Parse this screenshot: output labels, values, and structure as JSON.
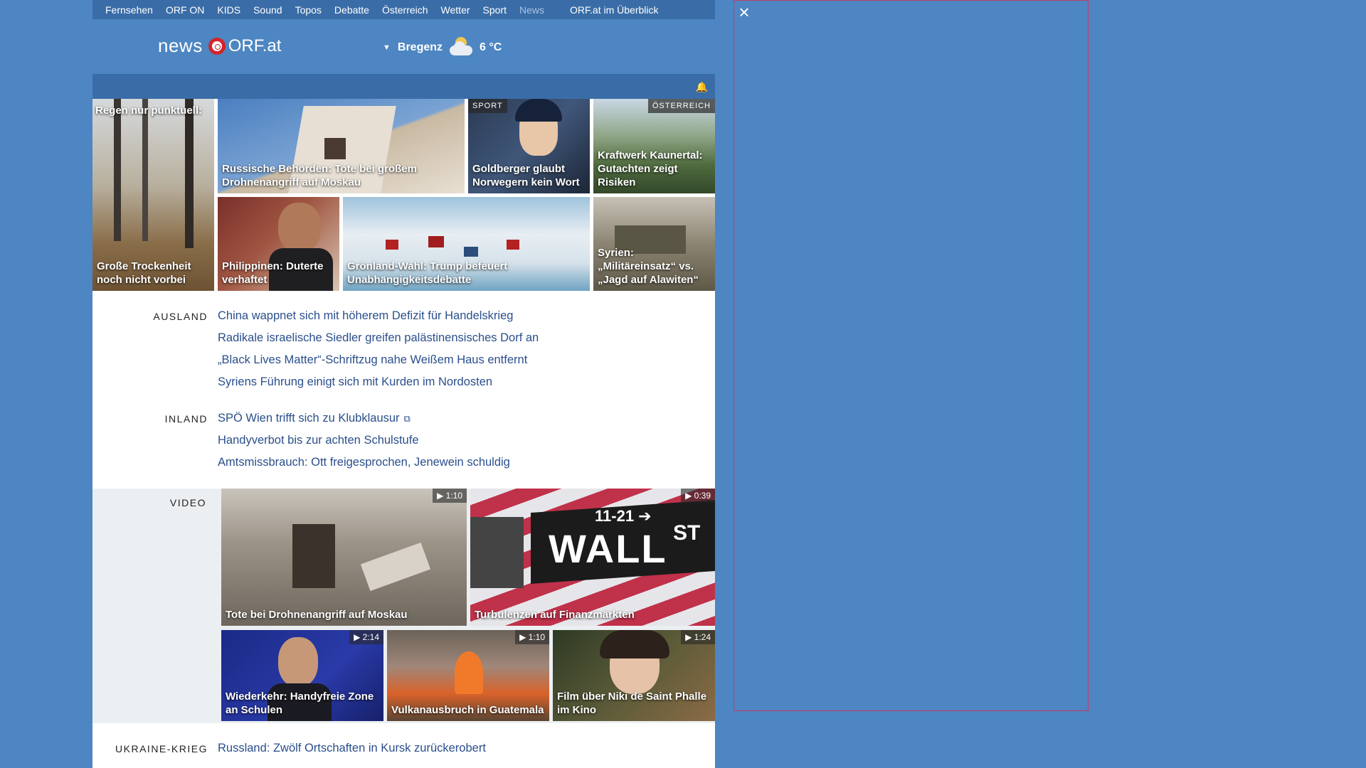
{
  "nav": {
    "items": [
      "Fernsehen",
      "ORF ON",
      "KIDS",
      "Sound",
      "Topos",
      "Debatte",
      "Österreich",
      "Wetter",
      "Sport",
      "News"
    ],
    "overview": "ORF.at im Überblick"
  },
  "header": {
    "logo_news": "news",
    "logo_orf": "ORF.at",
    "weather_city": "Bregenz",
    "weather_temp": "6 °C"
  },
  "teasers": [
    {
      "caption_top": "Regen nur punktuell:",
      "caption": "Große Trockenheit noch nicht vorbei"
    },
    {
      "caption": "Russische Behörden: Tote bei großem Drohnenangriff auf Moskau"
    },
    {
      "badge": "SPORT",
      "caption": "Goldberger glaubt Norwegern kein Wort"
    },
    {
      "badge": "ÖSTERREICH",
      "caption": "Kraftwerk Kaunertal: Gutachten zeigt Risiken"
    },
    {
      "caption": "Philippinen: Duterte verhaftet"
    },
    {
      "caption": "Grönland-Wahl: Trump befeuert Unabhängigkeitsdebatte"
    },
    {
      "caption": "Syrien: „Militäreinsatz“ vs. „Jagd auf Alawiten“"
    }
  ],
  "ausland": {
    "label": "AUSLAND",
    "links": [
      "China wappnet sich mit höherem Defizit für Handelskrieg",
      "Radikale israelische Siedler greifen palästinensisches Dorf an",
      "„Black Lives Matter“-Schriftzug nahe Weißem Haus entfernt",
      "Syriens Führung einigt sich mit Kurden im Nordosten"
    ]
  },
  "inland": {
    "label": "INLAND",
    "links": [
      "SPÖ Wien trifft sich zu Klubklausur",
      "Handyverbot bis zur achten Schulstufe",
      "Amtsmissbrauch: Ott freigesprochen, Jenewein schuldig"
    ]
  },
  "video": {
    "label": "VIDEO",
    "items": [
      {
        "caption": "Tote bei Drohnenangriff auf Moskau",
        "duration": "▶ 1:10"
      },
      {
        "caption": "Turbulenzen auf Finanzmärkten",
        "duration": "▶ 0:39",
        "sign_street": "WALL",
        "sign_st": "ST",
        "sign_num": "11-21 ➔"
      },
      {
        "caption": "Wiederkehr: Handyfreie Zone an Schulen",
        "duration": "▶ 2:14"
      },
      {
        "caption": "Vulkanausbruch in Guatemala",
        "duration": "▶ 1:10"
      },
      {
        "caption": "Film über Niki de Saint Phalle im Kino",
        "duration": "▶ 1:24"
      }
    ]
  },
  "ukraine": {
    "label": "UKRAINE-KRIEG",
    "link": "Russland: Zwölf Ortschaften in Kursk zurückerobert"
  },
  "icons": {
    "close": "×",
    "bell": "🔔",
    "external": "⧉",
    "dropdown": "▼"
  }
}
